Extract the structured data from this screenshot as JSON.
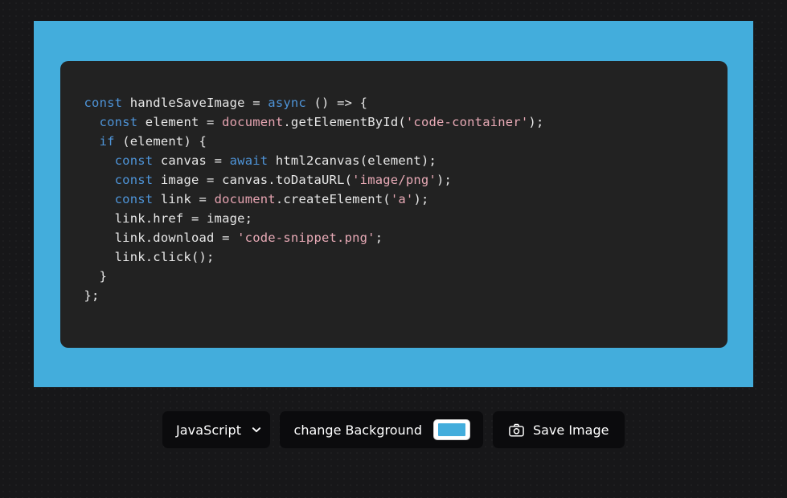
{
  "app": {
    "page_background": "#171719"
  },
  "capture_area": {
    "name": "code screenshot backdrop",
    "background_color": "#43ADDC"
  },
  "code_container": {
    "id_label": "code-container",
    "background_color": "#222222",
    "language": "JavaScript",
    "lines": [
      [
        {
          "t": "const",
          "c": "kw"
        },
        {
          "t": " handleSaveImage = ",
          "c": "plain"
        },
        {
          "t": "async",
          "c": "kw"
        },
        {
          "t": " () => {",
          "c": "plain"
        }
      ],
      [
        {
          "t": "  ",
          "c": "plain"
        },
        {
          "t": "const",
          "c": "kw"
        },
        {
          "t": " element = ",
          "c": "plain"
        },
        {
          "t": "document",
          "c": "obj"
        },
        {
          "t": ".getElementById(",
          "c": "plain"
        },
        {
          "t": "'code-container'",
          "c": "str"
        },
        {
          "t": ");",
          "c": "plain"
        }
      ],
      [
        {
          "t": "  ",
          "c": "plain"
        },
        {
          "t": "if",
          "c": "kw"
        },
        {
          "t": " (element) {",
          "c": "plain"
        }
      ],
      [
        {
          "t": "    ",
          "c": "plain"
        },
        {
          "t": "const",
          "c": "kw"
        },
        {
          "t": " canvas = ",
          "c": "plain"
        },
        {
          "t": "await",
          "c": "kw"
        },
        {
          "t": " html2canvas(element);",
          "c": "plain"
        }
      ],
      [
        {
          "t": "    ",
          "c": "plain"
        },
        {
          "t": "const",
          "c": "kw"
        },
        {
          "t": " image = canvas.toDataURL(",
          "c": "plain"
        },
        {
          "t": "'image/png'",
          "c": "str"
        },
        {
          "t": ");",
          "c": "plain"
        }
      ],
      [
        {
          "t": "    ",
          "c": "plain"
        },
        {
          "t": "const",
          "c": "kw"
        },
        {
          "t": " link = ",
          "c": "plain"
        },
        {
          "t": "document",
          "c": "obj"
        },
        {
          "t": ".createElement(",
          "c": "plain"
        },
        {
          "t": "'a'",
          "c": "str"
        },
        {
          "t": ");",
          "c": "plain"
        }
      ],
      [
        {
          "t": "    link.href = image;",
          "c": "plain"
        }
      ],
      [
        {
          "t": "    link.download = ",
          "c": "plain"
        },
        {
          "t": "'code-snippet.png'",
          "c": "str"
        },
        {
          "t": ";",
          "c": "plain"
        }
      ],
      [
        {
          "t": "    link.click();",
          "c": "plain"
        }
      ],
      [
        {
          "t": "  }",
          "c": "plain"
        }
      ],
      [
        {
          "t": "};",
          "c": "plain"
        }
      ]
    ]
  },
  "toolbar": {
    "language_select": {
      "selected": "JavaScript",
      "options": [
        "JavaScript"
      ],
      "chevron_icon": "chevron-down-icon"
    },
    "change_background": {
      "label": "change Background",
      "color_value": "#43ADDC"
    },
    "save_image": {
      "label": "Save Image",
      "icon": "camera-icon"
    }
  }
}
